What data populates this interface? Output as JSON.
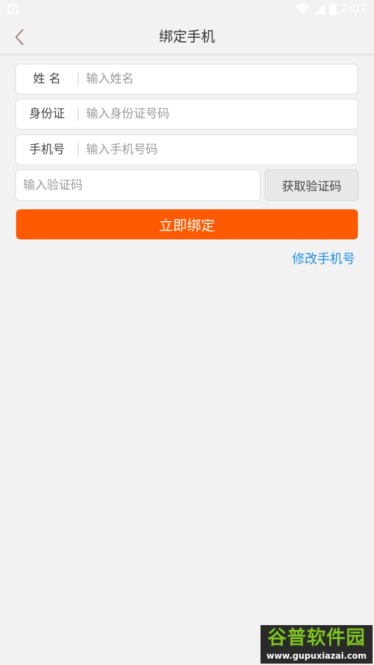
{
  "status_bar": {
    "time": "2:07",
    "icons": [
      "notification-icon",
      "wifi-icon",
      "signal-icon",
      "battery-icon"
    ]
  },
  "header": {
    "title": "绑定手机",
    "back_icon": "chevron-left-icon"
  },
  "form": {
    "name": {
      "label": "姓 名",
      "placeholder": "输入姓名"
    },
    "id_card": {
      "label": "身份证",
      "placeholder": "输入身份证号码"
    },
    "phone": {
      "label": "手机号",
      "placeholder": "输入手机号码"
    },
    "code": {
      "placeholder": "输入验证码",
      "button_label": "获取验证码"
    },
    "submit_label": "立即绑定",
    "modify_phone_label": "修改手机号"
  },
  "watermark": {
    "title": "谷普软件园",
    "url": "www.gupuxiazai.com"
  },
  "colors": {
    "accent": "#ff5a00",
    "link": "#1e90e6",
    "background": "#f2f2f2"
  }
}
